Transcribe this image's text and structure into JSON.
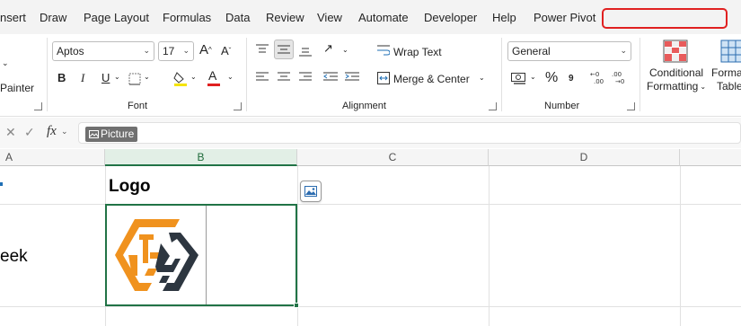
{
  "tabs": [
    "nsert",
    "Draw",
    "Page Layout",
    "Formulas",
    "Data",
    "Review",
    "View",
    "Automate",
    "Developer",
    "Help",
    "Power Pivot"
  ],
  "ribbon": {
    "clipboard": {
      "painter_label": "Painter"
    },
    "font": {
      "group_label": "Font",
      "font_name": "Aptos",
      "font_size": "17",
      "bold": "B",
      "italic": "I",
      "underline": "U",
      "grow_font": "A",
      "shrink_font": "A"
    },
    "alignment": {
      "group_label": "Alignment",
      "wrap_text": "Wrap Text",
      "merge_center": "Merge & Center"
    },
    "number": {
      "group_label": "Number",
      "format": "General",
      "percent": "%"
    },
    "styles": {
      "conditional_formatting": "Conditional",
      "conditional_formatting_2": "Formatting",
      "format_as_table": "Format",
      "format_as_table_2": "Table"
    }
  },
  "formula_bar": {
    "fx": "fx",
    "content": "Picture"
  },
  "columns": [
    "A",
    "B",
    "C",
    "D"
  ],
  "cells": {
    "b_header": "Logo",
    "a_row": "eek"
  },
  "colors": {
    "accent_green": "#217346",
    "logo_orange": "#f0921e",
    "logo_navy": "#2d3640",
    "search_outline": "#e02020"
  }
}
